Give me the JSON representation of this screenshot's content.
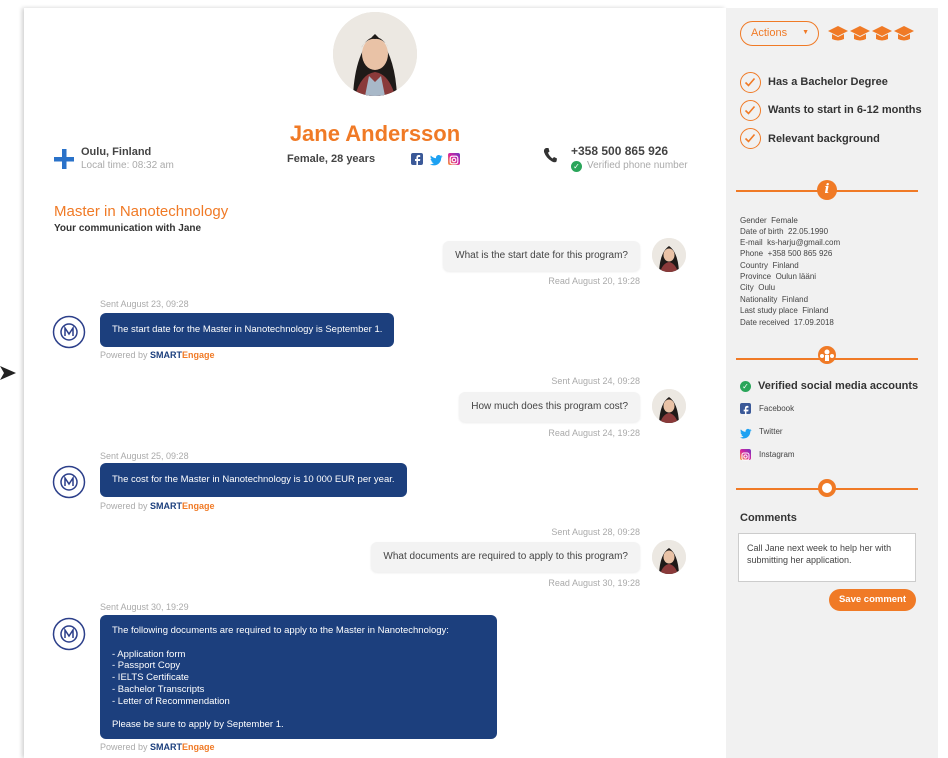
{
  "profile": {
    "name": "Jane Andersson",
    "gender_age": "Female, 28 years",
    "location": "Oulu, Finland",
    "local_time": "Local time: 08:32 am",
    "phone": "+358 500 865 926",
    "phone_verified": "Verified phone number"
  },
  "program": {
    "title": "Master in Nanotechnology",
    "subtitle": "Your communication with Jane"
  },
  "chat": {
    "m1": {
      "text": "What is the start date for this program?",
      "read": "Read August 20, 19:28"
    },
    "m2": {
      "sent": "Sent August 23, 09:28",
      "text": "The start date for the Master in Nanotechnology is September 1."
    },
    "m3": {
      "sent": "Sent August 24, 09:28",
      "text": "How much does this program cost?",
      "read": "Read August 24, 19:28"
    },
    "m4": {
      "sent": "Sent August 25, 09:28",
      "text": "The cost for the Master in Nanotechnology is 10 000 EUR per year."
    },
    "m5": {
      "sent": "Sent August 28, 09:28",
      "text": "What documents are required to apply to this program?",
      "read": "Read August 30, 19:28"
    },
    "m6": {
      "sent": "Sent August 30, 19:29",
      "lines": [
        "The following documents are required to apply to the Master in Nanotechnology:",
        "",
        "- Application form",
        "- Passport Copy",
        "- IELTS Certificate",
        "- Bachelor Transcripts",
        "- Letter of Recommendation",
        "",
        "Please be sure to apply by September 1."
      ]
    },
    "powered_prefix": "Powered by ",
    "powered_brand_a": "SMART",
    "powered_brand_b": "Engage"
  },
  "sidebar": {
    "actions_label": "Actions",
    "criteria": [
      "Has a Bachelor Degree",
      "Wants to start in 6-12 months",
      "Relevant background"
    ],
    "info": [
      {
        "k": "Gender",
        "v": "Female"
      },
      {
        "k": "Date of birth",
        "v": "22.05.1990"
      },
      {
        "k": "E-mail",
        "v": "ks-harju@gmail.com"
      },
      {
        "k": "Phone",
        "v": "+358 500 865 926"
      },
      {
        "k": "Country",
        "v": "Finland"
      },
      {
        "k": "Province",
        "v": "Oulun lääni"
      },
      {
        "k": "City",
        "v": "Oulu"
      },
      {
        "k": "Nationality",
        "v": "Finland"
      },
      {
        "k": "Last study place",
        "v": "Finland"
      },
      {
        "k": "Date received",
        "v": "17.09.2018"
      }
    ],
    "social_title": "Verified social media accounts",
    "social": [
      "Facebook",
      "Twitter",
      "Instagram"
    ],
    "comments_title": "Comments",
    "comment_text": "Call Jane next week to help her with submitting her application.",
    "save_label": "Save comment"
  },
  "colors": {
    "accent": "#f07a26",
    "bot_bubble": "#1c3f7d",
    "verified": "#2aa55a"
  }
}
